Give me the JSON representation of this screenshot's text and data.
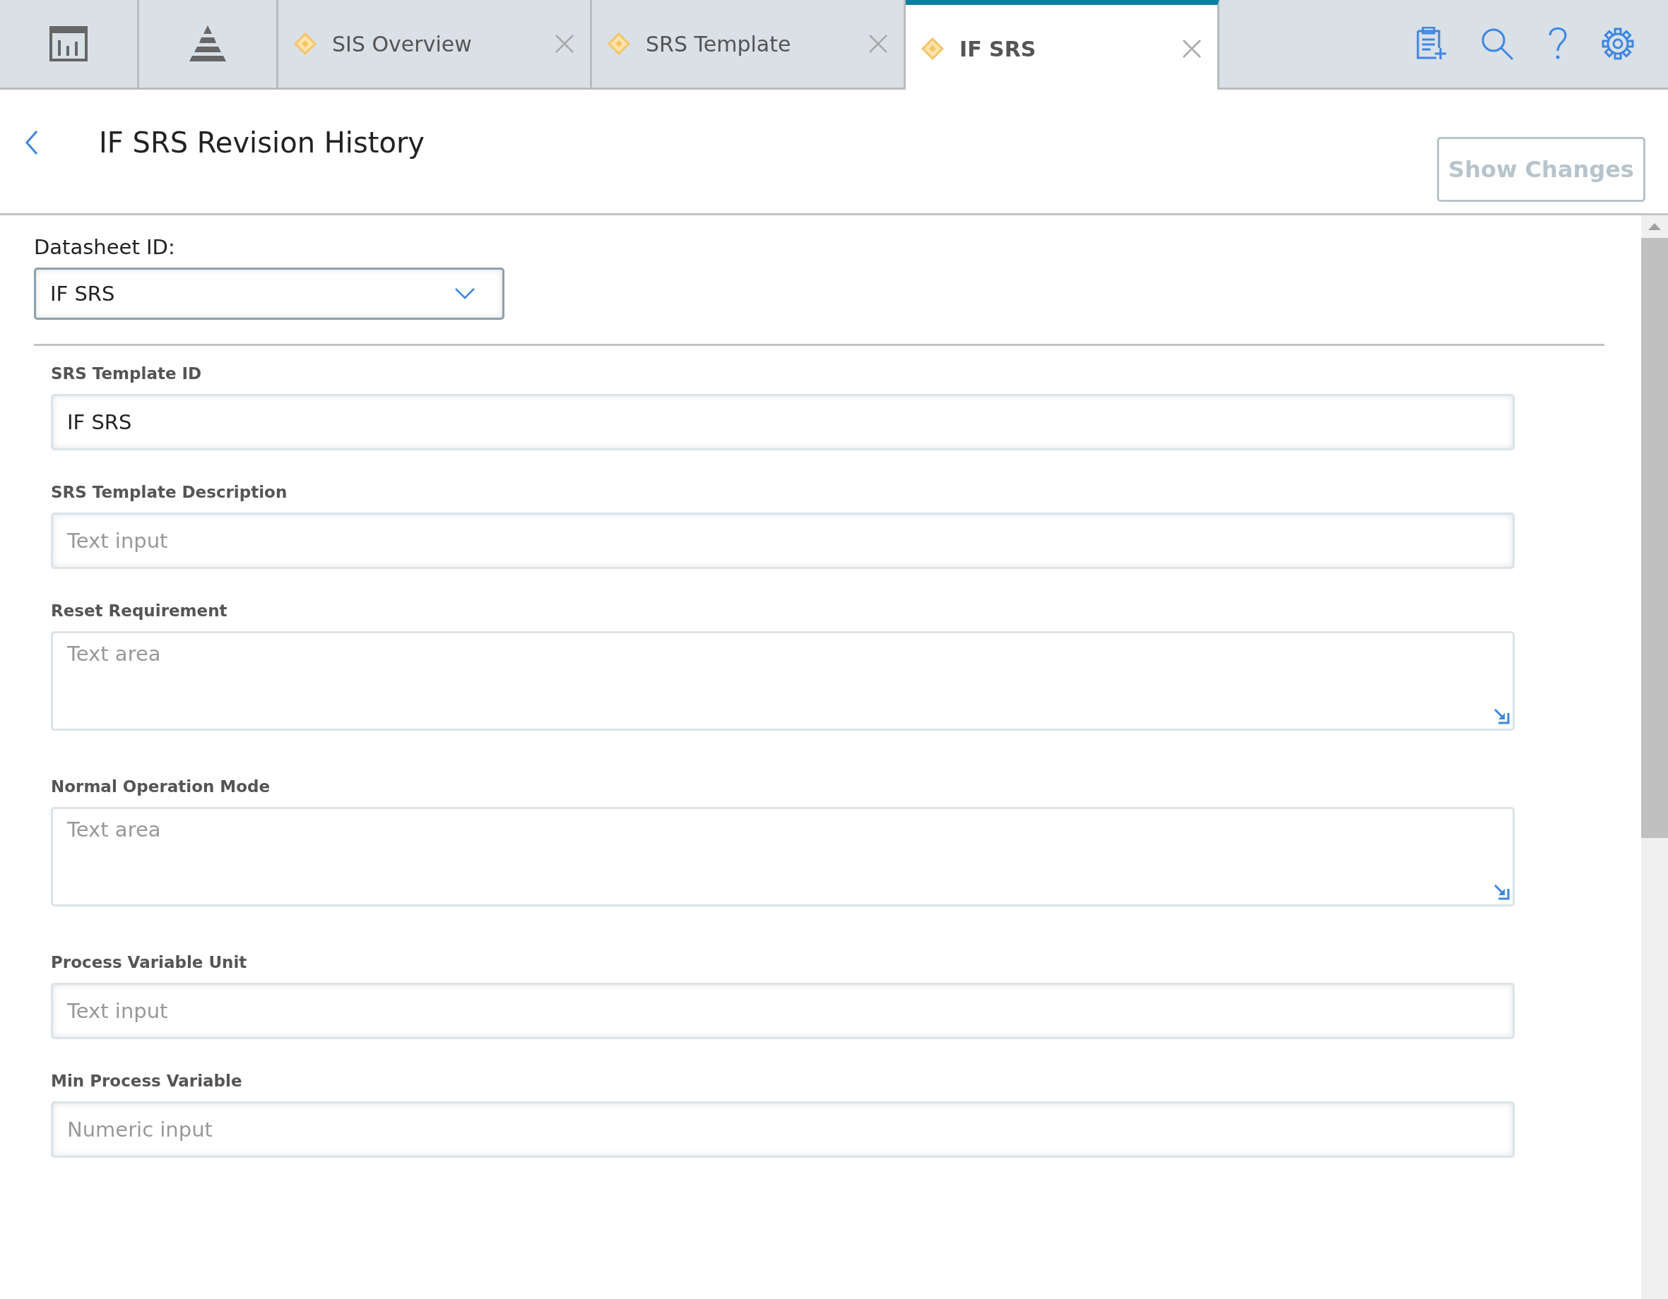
{
  "tabs": [
    {
      "label": "SIS Overview",
      "selected": false
    },
    {
      "label": "SRS Template",
      "selected": false
    },
    {
      "label": "IF SRS",
      "selected": true
    }
  ],
  "header": {
    "title": "IF SRS Revision History",
    "show_changes": {
      "label": "Show Changes",
      "disabled": true
    }
  },
  "datasheet": {
    "label": "Datasheet ID:",
    "value": "IF SRS"
  },
  "fields": [
    {
      "label": "SRS Template ID",
      "kind": "input",
      "value": "IF SRS"
    },
    {
      "label": "SRS Template Description",
      "kind": "input",
      "placeholder": "Text input"
    },
    {
      "label": "Reset Requirement",
      "kind": "textarea",
      "placeholder": "Text area"
    },
    {
      "label": "Normal Operation Mode",
      "kind": "textarea",
      "placeholder": "Text area"
    },
    {
      "label": "Process Variable Unit",
      "kind": "input",
      "placeholder": "Text input"
    },
    {
      "label": "Min Process Variable",
      "kind": "input",
      "placeholder": "Numeric input"
    }
  ]
}
